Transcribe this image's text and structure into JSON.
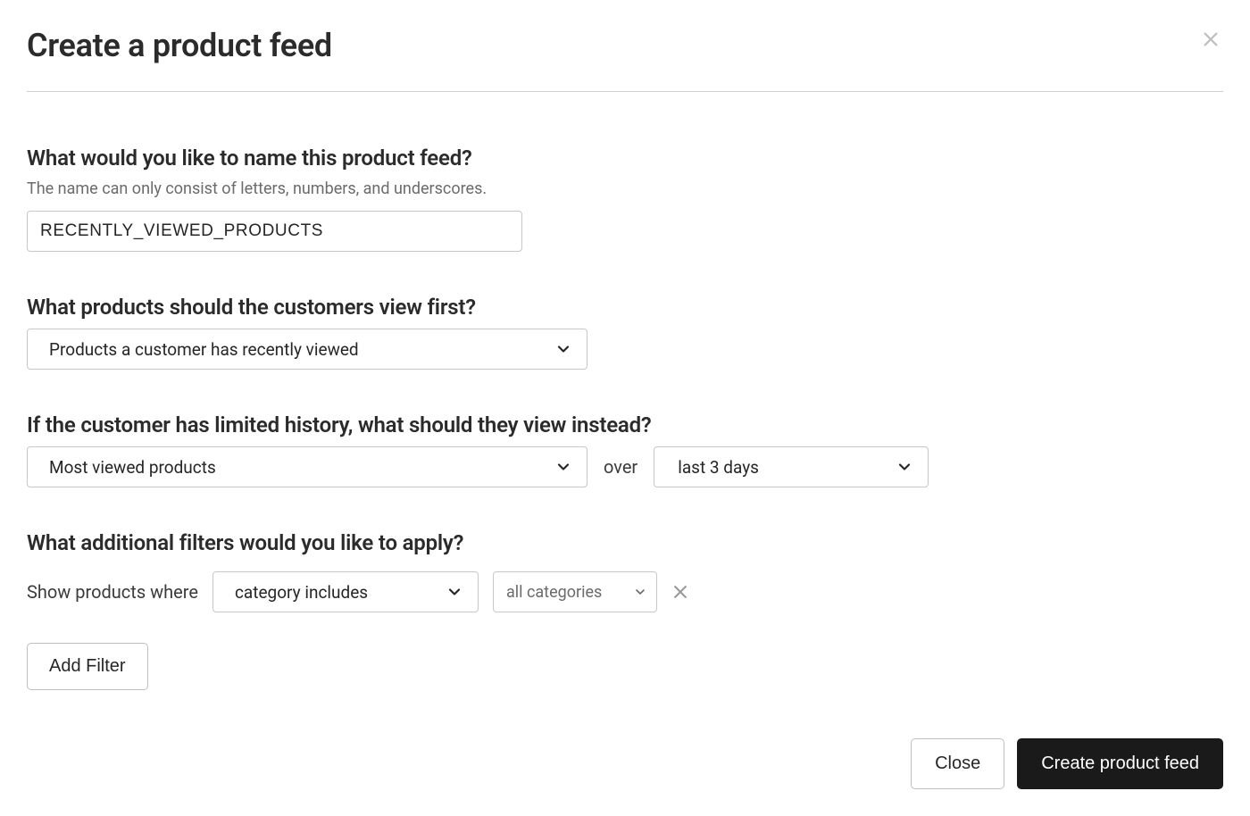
{
  "header": {
    "title": "Create a product feed"
  },
  "name_section": {
    "question": "What would you like to name this product feed?",
    "hint": "The name can only consist of letters, numbers, and underscores.",
    "value": "RECENTLY_VIEWED_PRODUCTS"
  },
  "view_first_section": {
    "question": "What products should the customers view first?",
    "selected": "Products a customer has recently viewed"
  },
  "fallback_section": {
    "question": "If the customer has limited history, what should they view instead?",
    "selected": "Most viewed products",
    "over_label": "over",
    "period_selected": "last 3 days"
  },
  "filters_section": {
    "question": "What additional filters would you like to apply?",
    "prefix": "Show products where",
    "filter_type_selected": "category includes",
    "filter_value_selected": "all categories",
    "add_filter_label": "Add Filter"
  },
  "footer": {
    "close_label": "Close",
    "create_label": "Create product feed"
  }
}
